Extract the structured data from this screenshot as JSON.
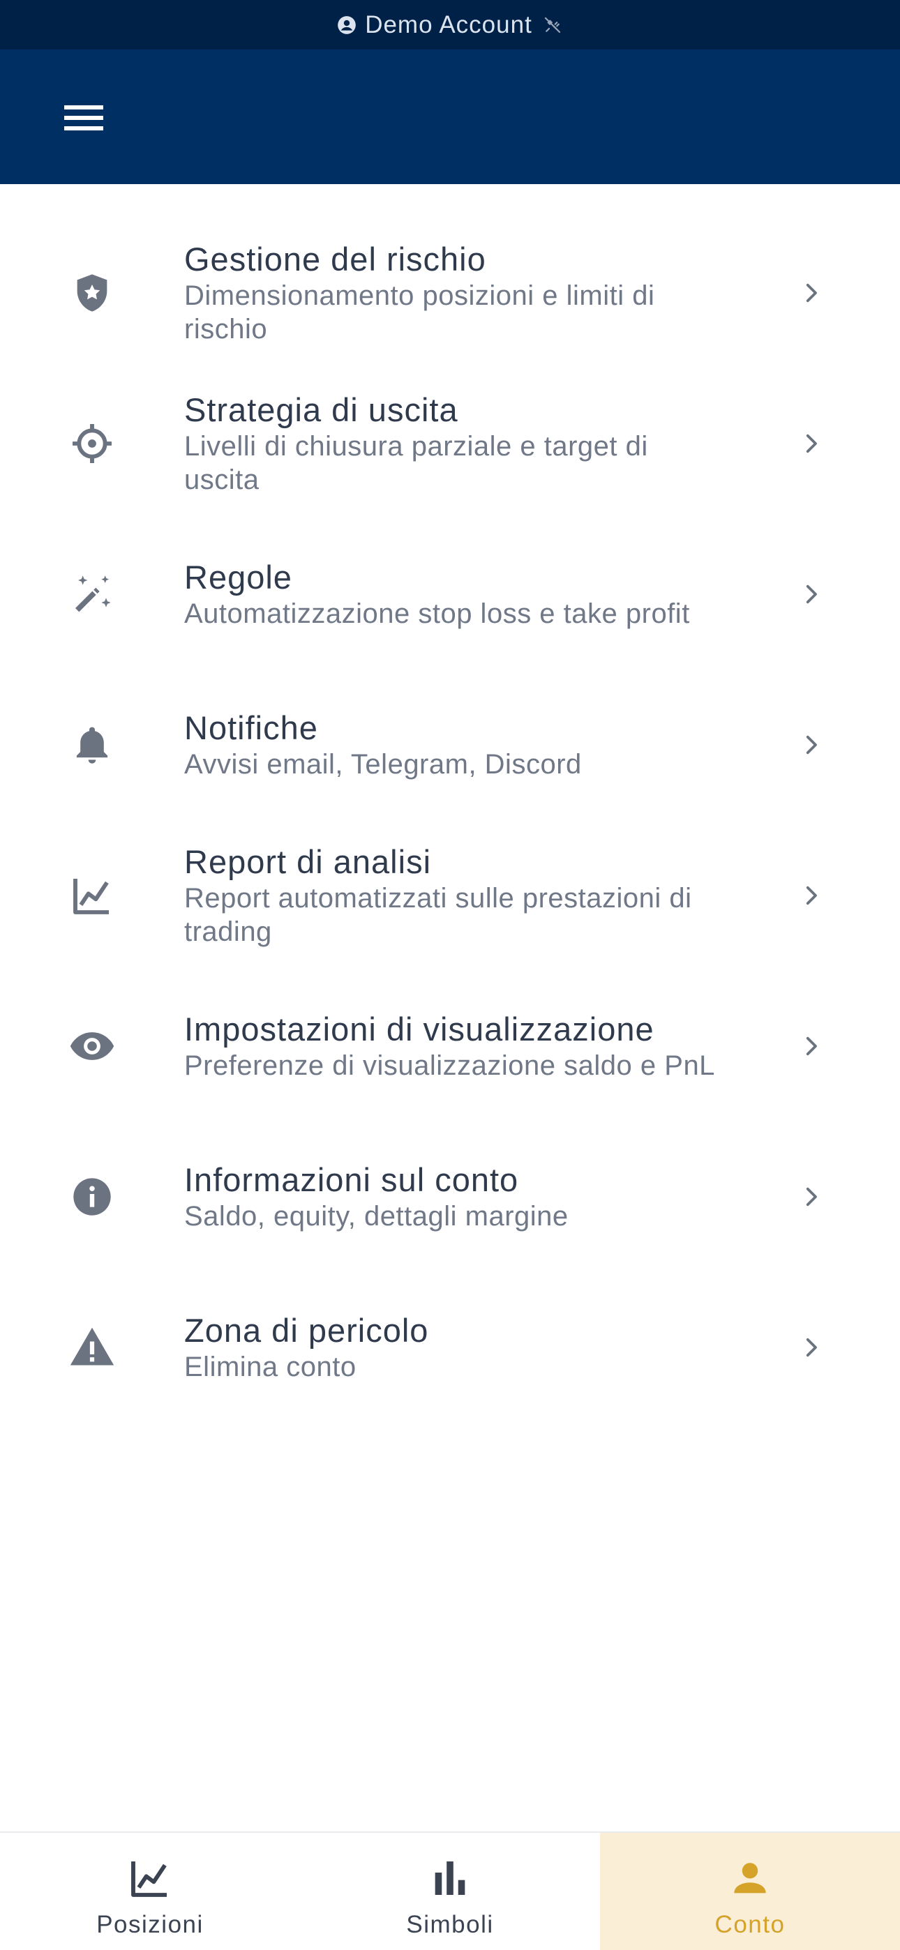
{
  "status_bar": {
    "label": "Demo Account",
    "account_icon": "account-circle-icon",
    "connection_icon": "unplugged-icon"
  },
  "app_bar": {
    "menu_icon": "hamburger-menu-icon"
  },
  "menu": {
    "items": [
      {
        "title": "Gestione del rischio",
        "subtitle": "Dimensionamento posizioni e limiti di rischio",
        "icon": "shield-star-icon"
      },
      {
        "title": "Strategia di uscita",
        "subtitle": "Livelli di chiusura parziale e target di uscita",
        "icon": "crosshair-icon"
      },
      {
        "title": "Regole",
        "subtitle": "Automatizzazione stop loss e take profit",
        "icon": "magic-wand-icon"
      },
      {
        "title": "Notifiche",
        "subtitle": "Avvisi email, Telegram, Discord",
        "icon": "bell-icon"
      },
      {
        "title": "Report di analisi",
        "subtitle": "Report automatizzati sulle prestazioni di trading",
        "icon": "line-chart-icon"
      },
      {
        "title": "Impostazioni di visualizzazione",
        "subtitle": "Preferenze di visualizzazione saldo e PnL",
        "icon": "eye-icon"
      },
      {
        "title": "Informazioni sul conto",
        "subtitle": "Saldo, equity, dettagli margine",
        "icon": "info-icon"
      },
      {
        "title": "Zona di pericolo",
        "subtitle": "Elimina conto",
        "icon": "warning-icon"
      }
    ]
  },
  "bottom_nav": {
    "tabs": [
      {
        "label": "Posizioni",
        "icon": "line-chart-icon",
        "active": false
      },
      {
        "label": "Simboli",
        "icon": "bar-chart-icon",
        "active": false
      },
      {
        "label": "Conto",
        "icon": "person-icon",
        "active": true
      }
    ]
  },
  "colors": {
    "status_bar_bg": "#002147",
    "app_bar_bg": "#003063",
    "icon_gray": "#6b7280",
    "active_tab_bg": "#faeed7",
    "active_tab_accent": "#d5a22a"
  }
}
